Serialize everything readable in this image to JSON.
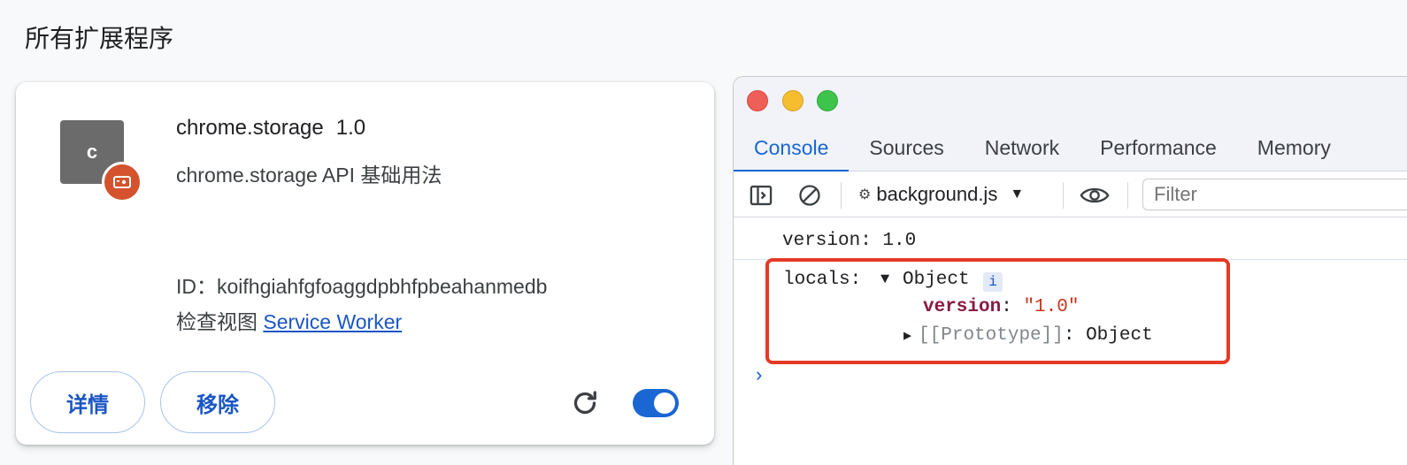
{
  "page": {
    "title": "所有扩展程序"
  },
  "extension": {
    "icon_letter": "c",
    "badge_icon": "service-worker-badge-icon",
    "name": "chrome.storage",
    "version": "1.0",
    "description": "chrome.storage API 基础用法",
    "id_text": "ID：koifhgiahfgfoaggdpbhfpbeahanmedb",
    "inspect_views_label": "检查视图",
    "service_worker_link": "Service Worker",
    "details_button": "详情",
    "remove_button": "移除",
    "reload_icon": "reload-icon",
    "enabled": true
  },
  "devtools": {
    "tabs": [
      "Console",
      "Sources",
      "Network",
      "Performance",
      "Memory"
    ],
    "active_tab": "Console",
    "context": "background.js",
    "filter_placeholder": "Filter",
    "console": {
      "log_line": "version: 1.0",
      "object_key": "locals:",
      "object_toggle": "▼",
      "object_type": "Object",
      "info_badge": "i",
      "prop_key": "version",
      "prop_colon": ":",
      "prop_value": "\"1.0\"",
      "proto_toggle": "▶",
      "proto_key": "[[Prototype]]",
      "proto_value": ": Object",
      "prompt": "›"
    }
  },
  "colors": {
    "accent": "#1a66d2",
    "highlight": "#e53a26",
    "badge": "#d4532e"
  }
}
